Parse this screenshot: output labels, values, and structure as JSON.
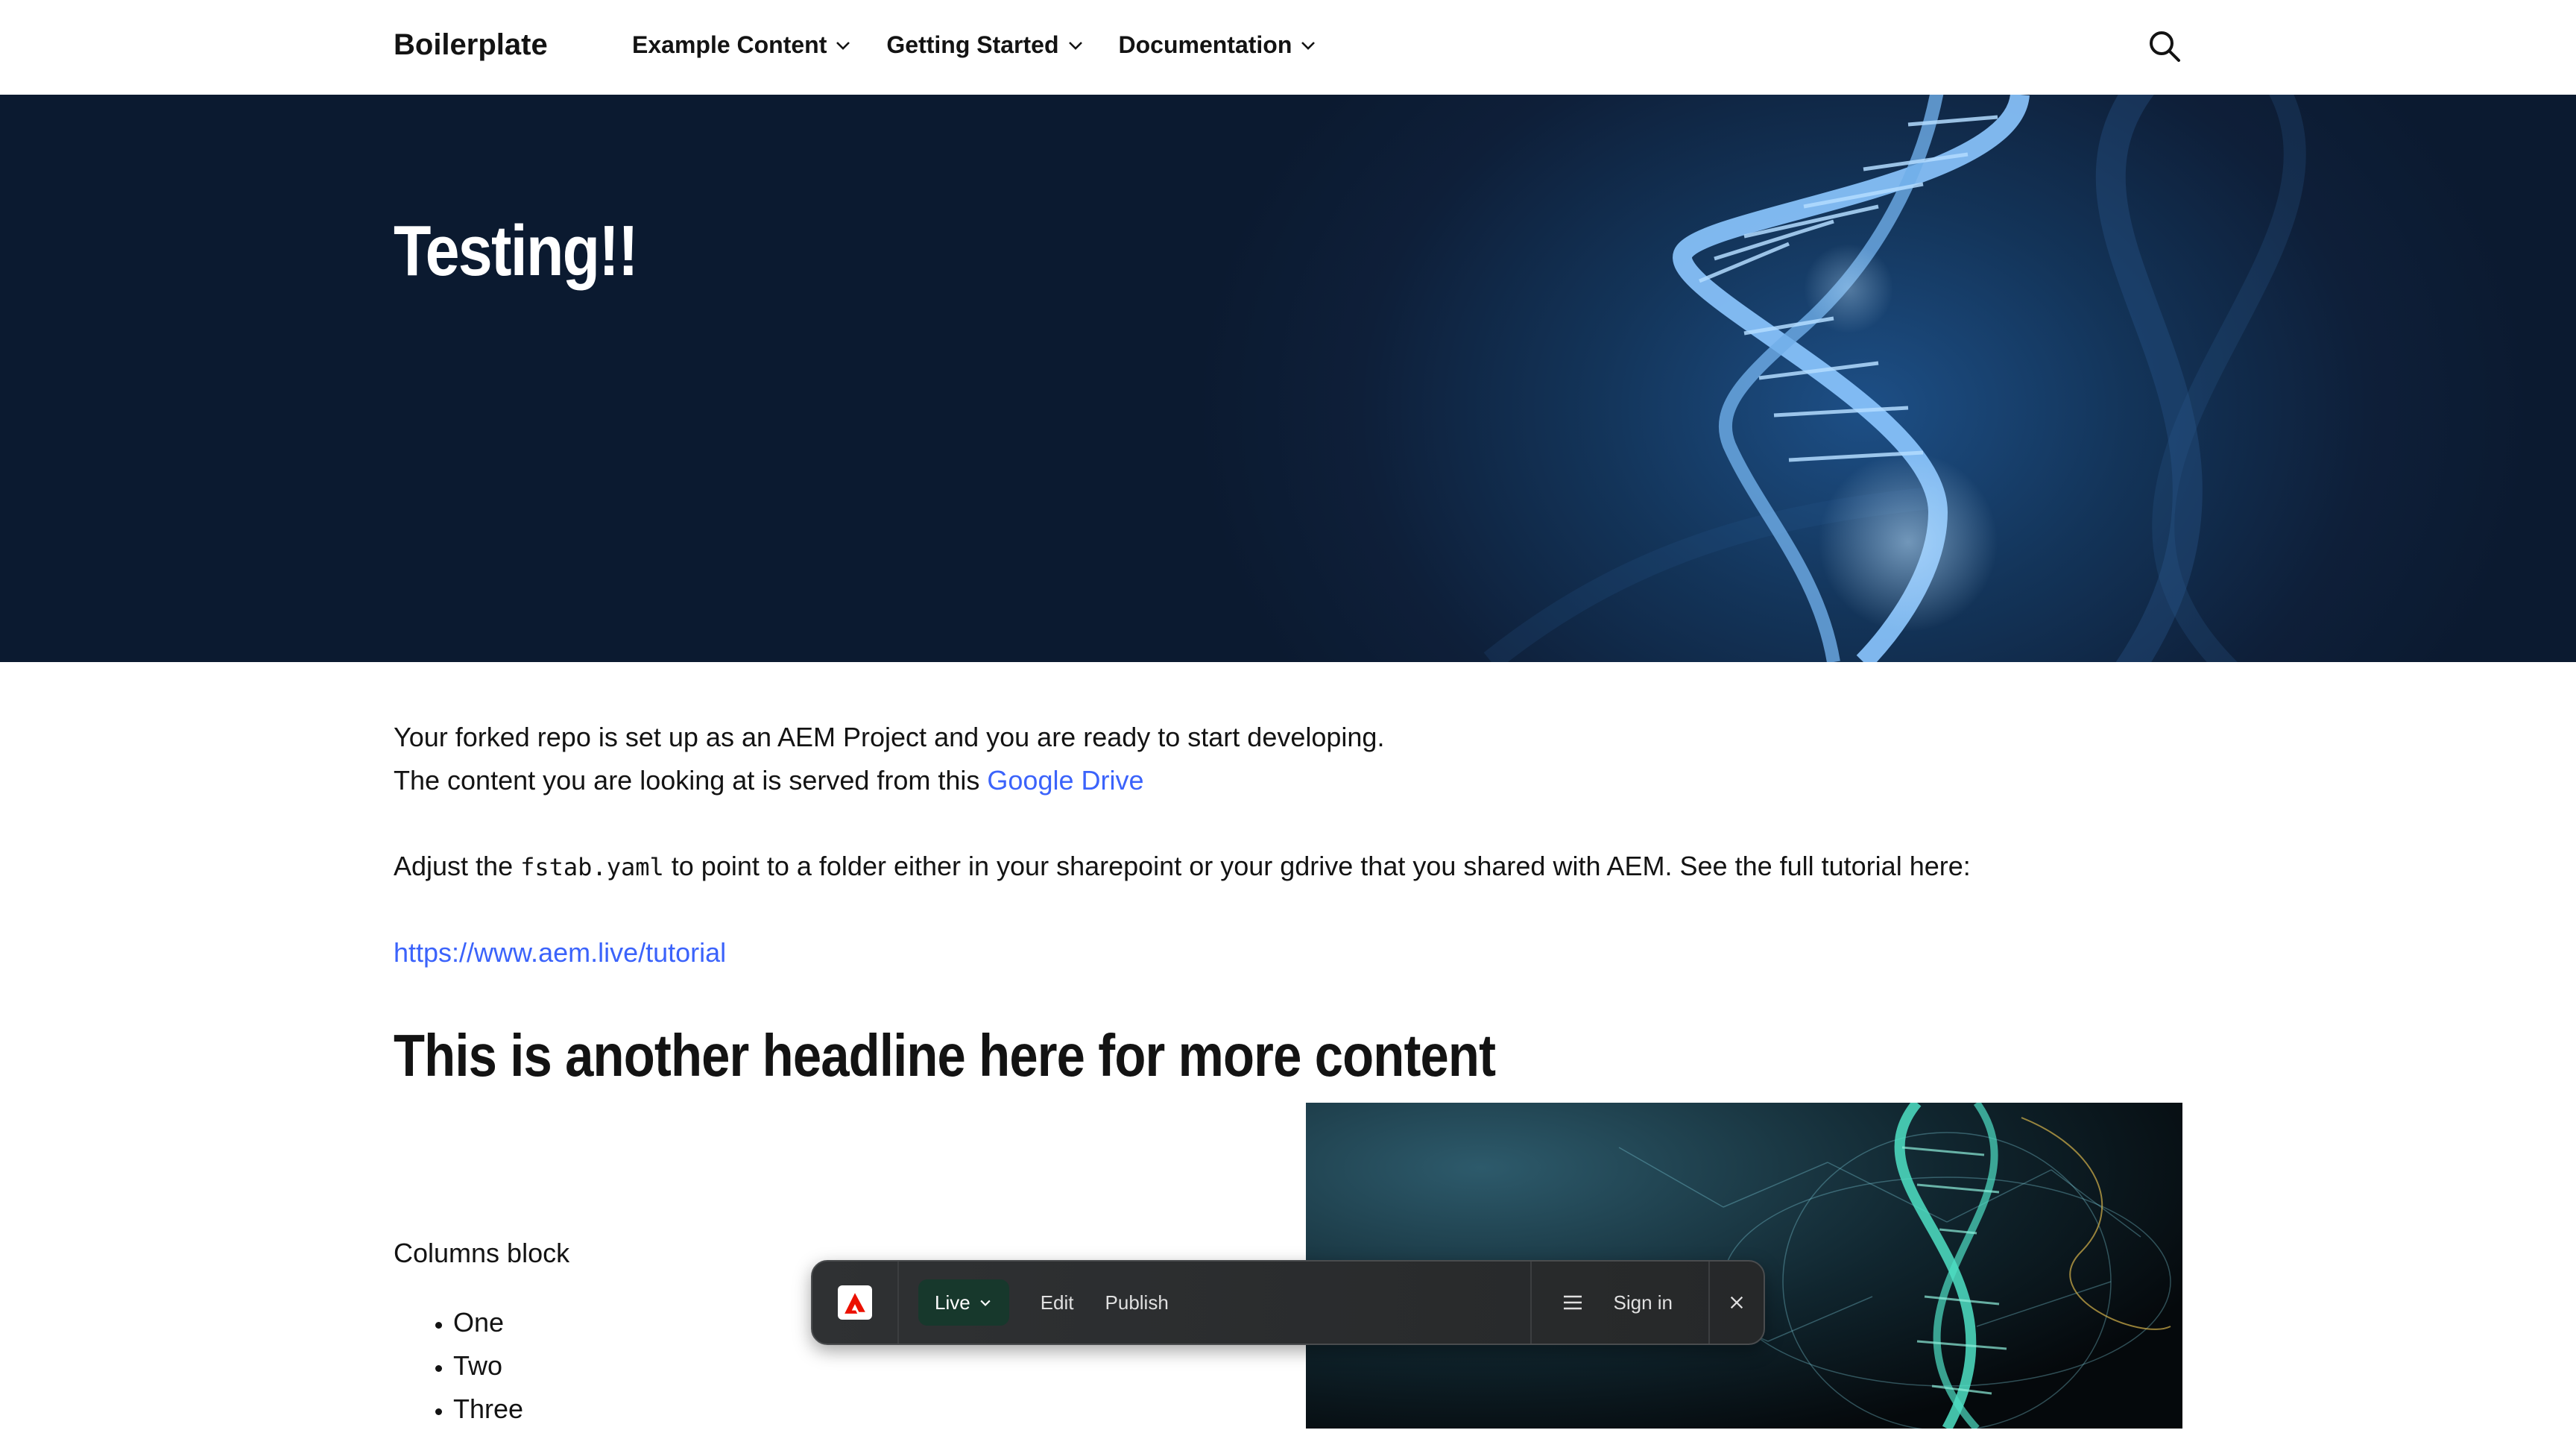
{
  "header": {
    "brand": "Boilerplate",
    "nav": [
      {
        "label": "Example Content"
      },
      {
        "label": "Getting Started"
      },
      {
        "label": "Documentation"
      }
    ]
  },
  "hero": {
    "title": "Testing!!"
  },
  "content": {
    "line1": "Your forked repo is set up as an AEM Project and you are ready to start developing.",
    "line2_prefix": "The content you are looking at is served from this ",
    "line2_link": "Google Drive",
    "adjust_prefix": "Adjust the ",
    "adjust_code": "fstab.yaml",
    "adjust_suffix": " to point to a folder either in your sharepoint or your gdrive that you shared with AEM. See the full tutorial here:",
    "tutorial_link": "https://www.aem.live/tutorial",
    "headline": "This is another headline here for more content",
    "columns_label": "Columns block",
    "list": [
      "One",
      "Two",
      "Three"
    ]
  },
  "sidekick": {
    "environment": "Live",
    "edit": "Edit",
    "publish": "Publish",
    "sign_in": "Sign in"
  },
  "colors": {
    "link": "#3b63fb",
    "hero_bg": "#0e1f39",
    "sidekick_env": "#17382c"
  }
}
